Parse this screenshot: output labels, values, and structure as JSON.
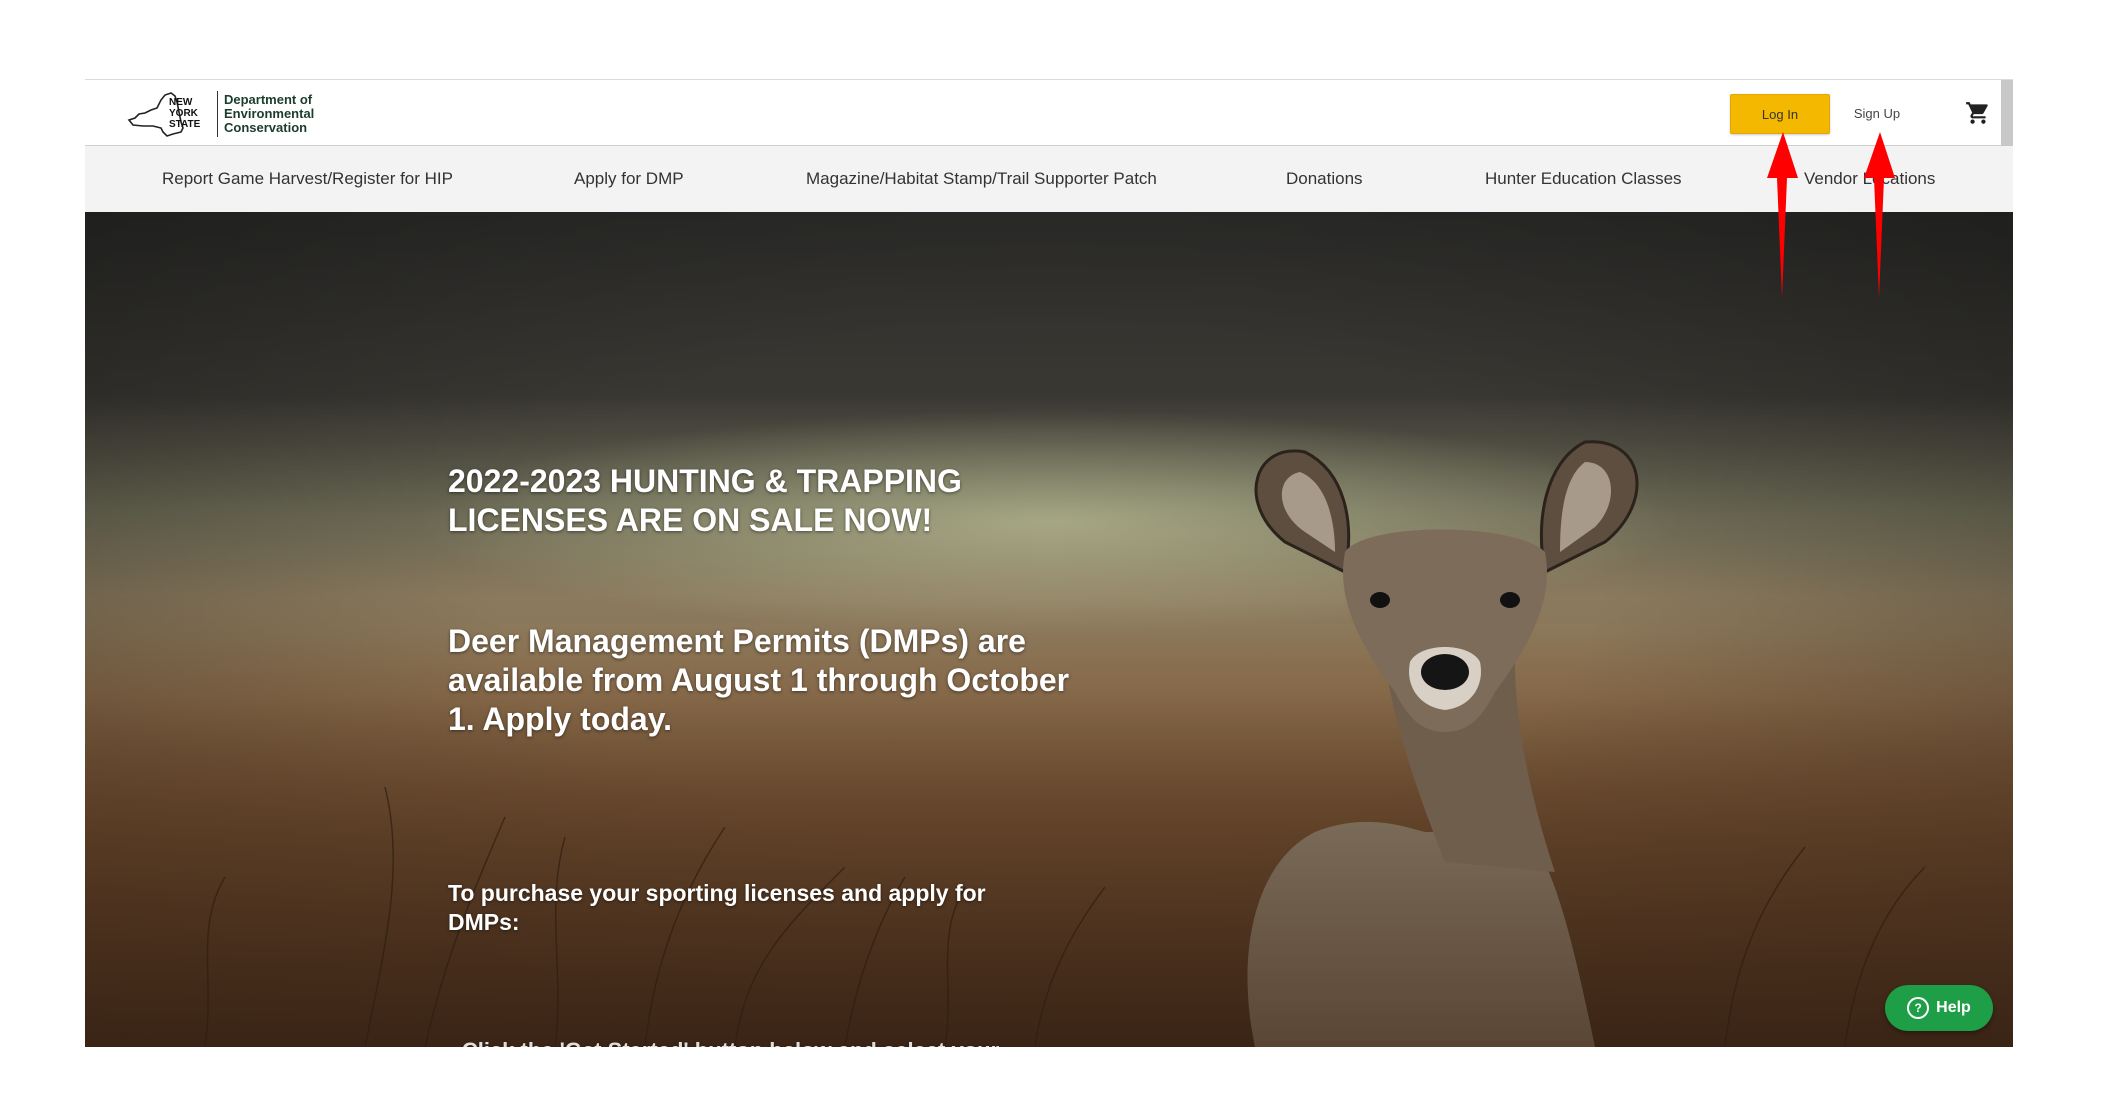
{
  "header": {
    "logo_state_lines": [
      "NEW",
      "YORK",
      "STATE"
    ],
    "logo_dept_lines": [
      "Department of",
      "Environmental",
      "Conservation"
    ],
    "login_label": "Log In",
    "signup_label": "Sign Up",
    "cart_icon": "shopping-cart-icon"
  },
  "nav": {
    "items": [
      {
        "label": "Report Game Harvest/Register for HIP"
      },
      {
        "label": "Apply for DMP"
      },
      {
        "label": "Magazine/Habitat Stamp/Trail Supporter Patch"
      },
      {
        "label": "Donations"
      },
      {
        "label": "Hunter Education Classes"
      },
      {
        "label": "Vendor Locations"
      }
    ]
  },
  "hero": {
    "headline": "2022-2023 HUNTING & TRAPPING LICENSES ARE ON SALE NOW!",
    "dmp_text": "Deer Management Permits (DMPs) are available from August 1 through October 1.  Apply today.",
    "purchase_text": "To purchase your sporting licenses and apply for DMPs:",
    "cutoff_text": "• Click the 'Get Started' button below and select your preferred"
  },
  "help": {
    "label": "Help",
    "icon": "question-circle-icon",
    "color": "#1e9e46"
  },
  "annotations": {
    "arrow_color": "#ff0000"
  },
  "colors": {
    "login_button": "#f5b800",
    "nav_background": "#f3f3f3"
  }
}
